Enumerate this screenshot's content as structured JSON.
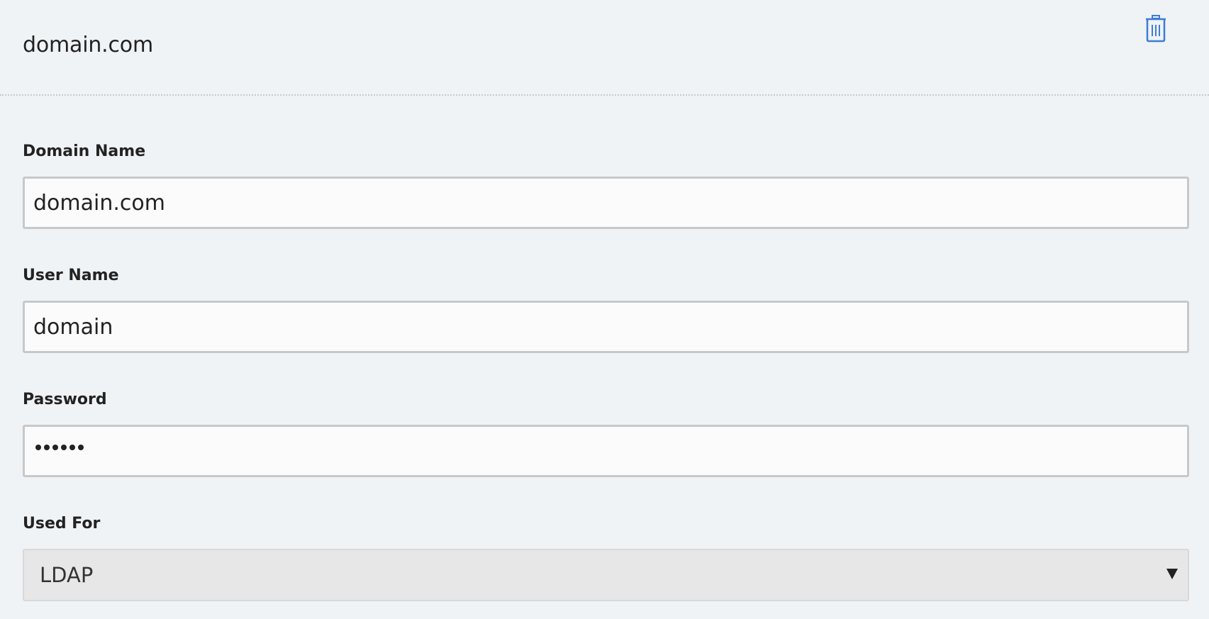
{
  "header": {
    "title": "domain.com",
    "delete_icon": "trash-icon",
    "accent_color": "#3b7dd8"
  },
  "form": {
    "domain_name": {
      "label": "Domain Name",
      "value": "domain.com"
    },
    "user_name": {
      "label": "User Name",
      "value": "domain"
    },
    "password": {
      "label": "Password",
      "value": "••••••"
    },
    "used_for": {
      "label": "Used For",
      "selected": "LDAP",
      "arrow_icon": "caret-down-icon"
    }
  }
}
